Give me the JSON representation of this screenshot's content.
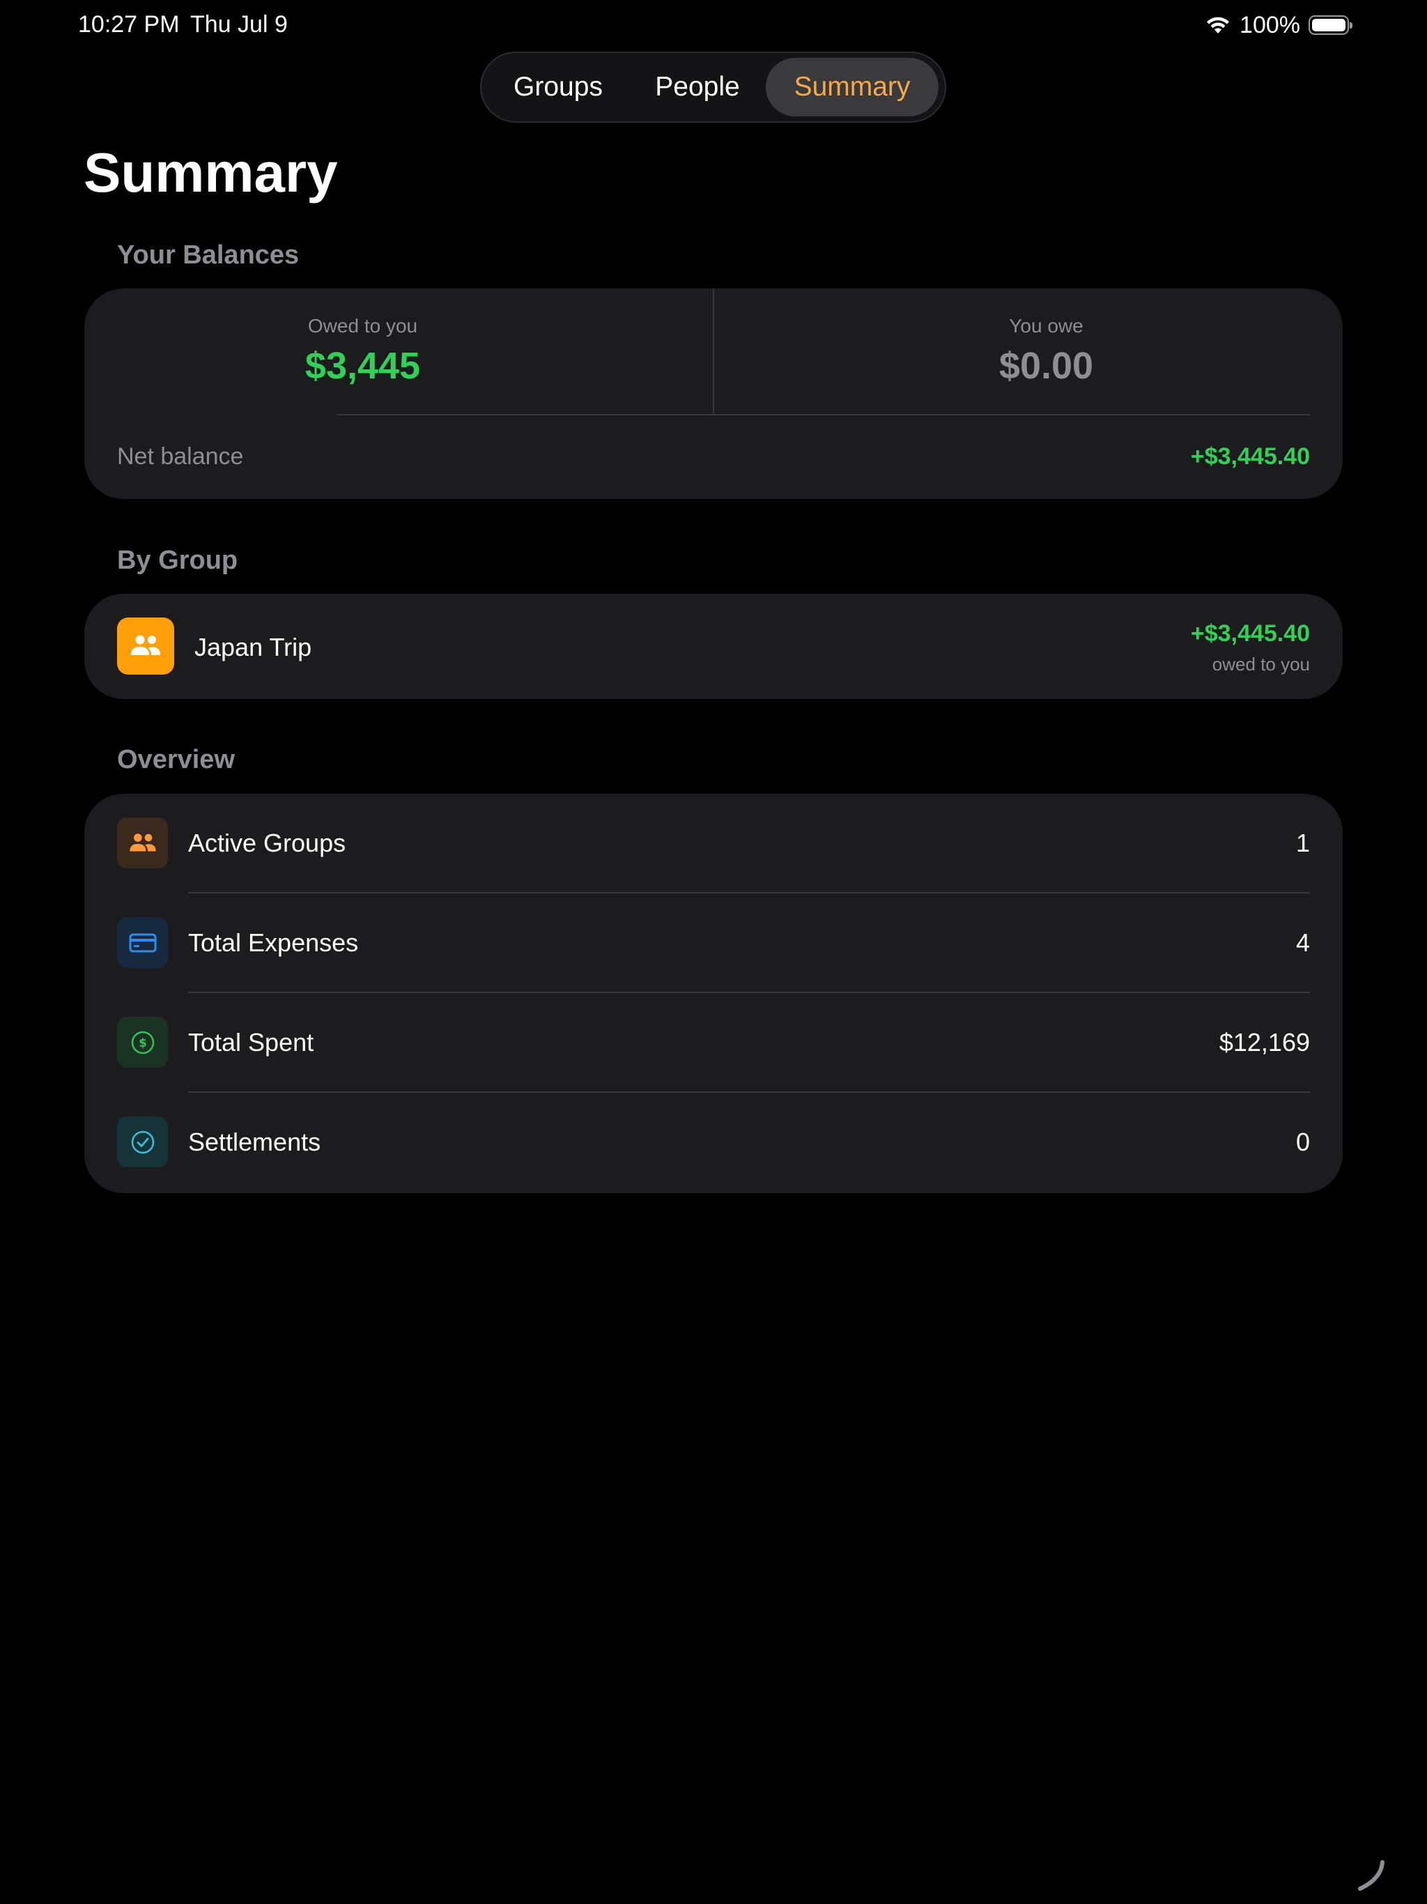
{
  "status_bar": {
    "time": "10:27 PM",
    "date": "Thu Jul 9",
    "battery": "100%"
  },
  "tabs": {
    "groups": "Groups",
    "people": "People",
    "summary": "Summary",
    "selected": "summary"
  },
  "page_title": "Summary",
  "balances": {
    "section_title": "Your Balances",
    "owed_to_you_label": "Owed to you",
    "owed_to_you_value": "$3,445",
    "you_owe_label": "You owe",
    "you_owe_value": "$0.00",
    "net_balance_label": "Net balance",
    "net_balance_value": "+$3,445.40"
  },
  "by_group": {
    "section_title": "By Group",
    "groups": [
      {
        "name": "Japan Trip",
        "amount": "+$3,445.40",
        "subtitle": "owed to you",
        "icon": "people-icon"
      }
    ]
  },
  "overview": {
    "section_title": "Overview",
    "rows": [
      {
        "label": "Active Groups",
        "value": "1",
        "icon": "people-icon"
      },
      {
        "label": "Total Expenses",
        "value": "4",
        "icon": "credit-card-icon"
      },
      {
        "label": "Total Spent",
        "value": "$12,169",
        "icon": "dollar-circle-icon"
      },
      {
        "label": "Settlements",
        "value": "0",
        "icon": "checkmark-circle-icon"
      }
    ]
  },
  "colors": {
    "background": "#000000",
    "card": "#1c1c1e",
    "accent_orange": "#f5a94a",
    "positive_green": "#32d058",
    "secondary_text": "#8e8e93",
    "group_icon_bg": "#ff9f0a"
  }
}
